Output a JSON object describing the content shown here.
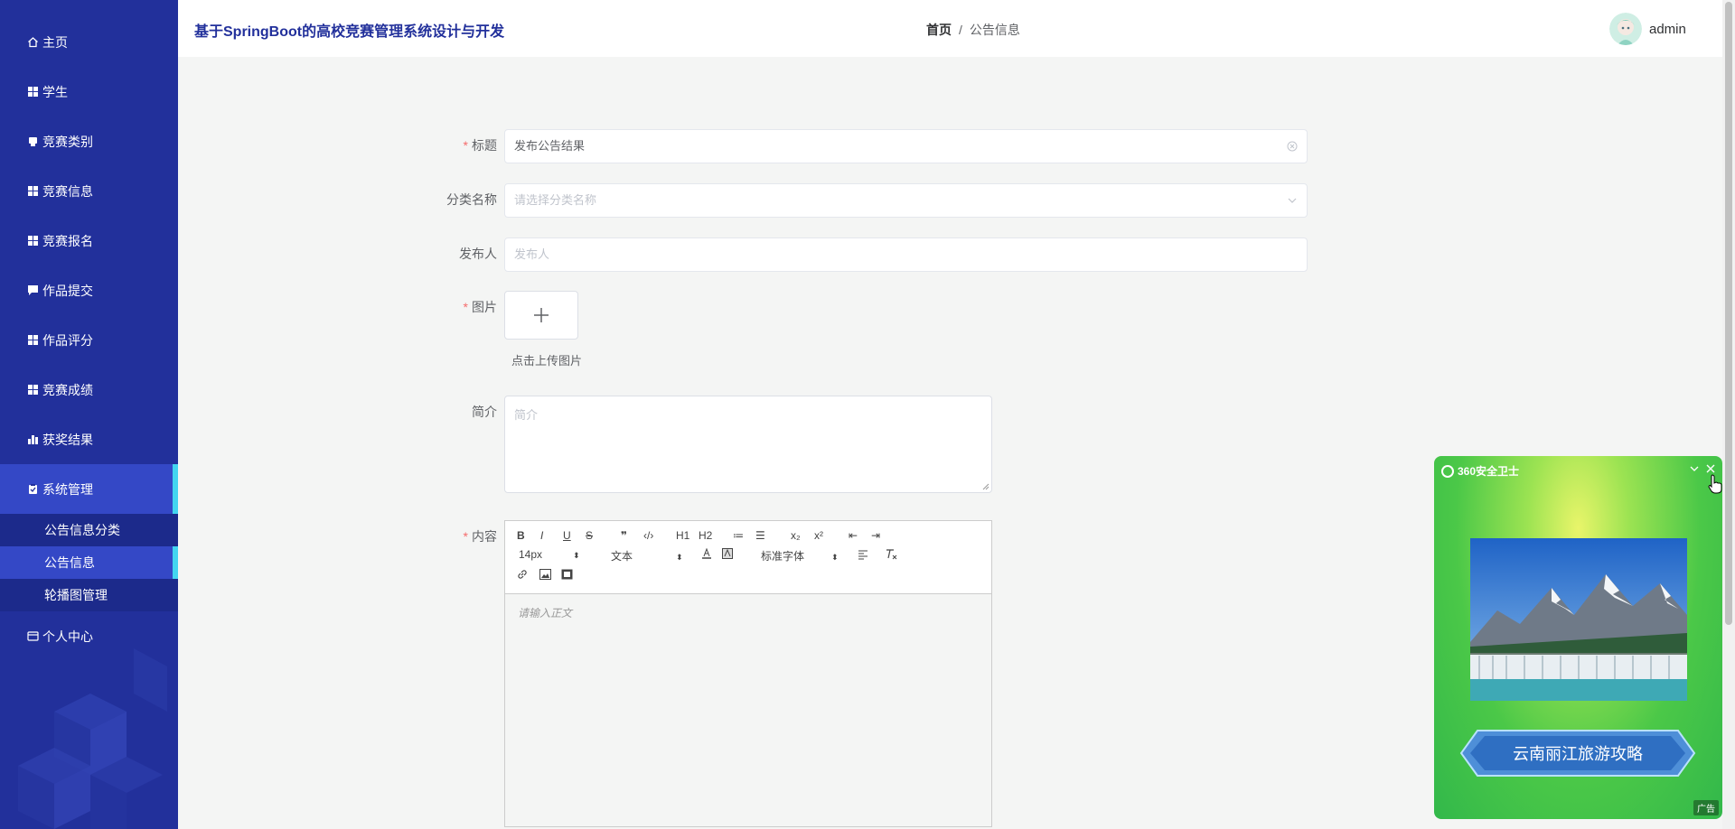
{
  "header": {
    "title": "基于SpringBoot的高校竞赛管理系统设计与开发",
    "breadcrumb": {
      "home": "首页",
      "separator": "/",
      "current": "公告信息"
    },
    "username": "admin"
  },
  "sidebar": {
    "items": [
      {
        "label": "主页",
        "icon": "home-icon"
      },
      {
        "label": "学生",
        "icon": "grid-icon"
      },
      {
        "label": "竞赛类别",
        "icon": "box-icon"
      },
      {
        "label": "竞赛信息",
        "icon": "grid-icon"
      },
      {
        "label": "竞赛报名",
        "icon": "grid-icon"
      },
      {
        "label": "作品提交",
        "icon": "comment-icon"
      },
      {
        "label": "作品评分",
        "icon": "grid-icon"
      },
      {
        "label": "竞赛成绩",
        "icon": "grid-icon"
      },
      {
        "label": "获奖结果",
        "icon": "bar-chart-icon"
      },
      {
        "label": "系统管理",
        "icon": "clipboard-icon"
      }
    ],
    "submenu": [
      {
        "label": "公告信息分类"
      },
      {
        "label": "公告信息"
      },
      {
        "label": "轮播图管理"
      }
    ],
    "personal": {
      "label": "个人中心",
      "icon": "card-icon"
    }
  },
  "form": {
    "title": {
      "label": "标题",
      "value": "发布公告结果",
      "required": true
    },
    "category": {
      "label": "分类名称",
      "placeholder": "请选择分类名称"
    },
    "publisher": {
      "label": "发布人",
      "placeholder": "发布人"
    },
    "image": {
      "label": "图片",
      "tip": "点击上传图片",
      "required": true
    },
    "intro": {
      "label": "简介",
      "placeholder": "简介"
    },
    "content": {
      "label": "内容",
      "required": true,
      "placeholder": "请输入正文"
    }
  },
  "editor": {
    "buttons": [
      "B",
      "I",
      "U",
      "S",
      "❞",
      "‹/›",
      "H1",
      "H2",
      "≔",
      "☰",
      "x₂",
      "x²",
      "⇤",
      "⇥"
    ],
    "font_size": "14px",
    "text_type": "文本",
    "font_family": "标准字体"
  },
  "ad": {
    "brand": "360安全卫士",
    "button": "云南丽江旅游攻略",
    "tag": "广告"
  },
  "colors": {
    "sidebar_bg": "#22309b",
    "active_bg": "#3448c6",
    "accent": "#42d5f0",
    "title": "#22309b",
    "required": "#f56c6c"
  }
}
